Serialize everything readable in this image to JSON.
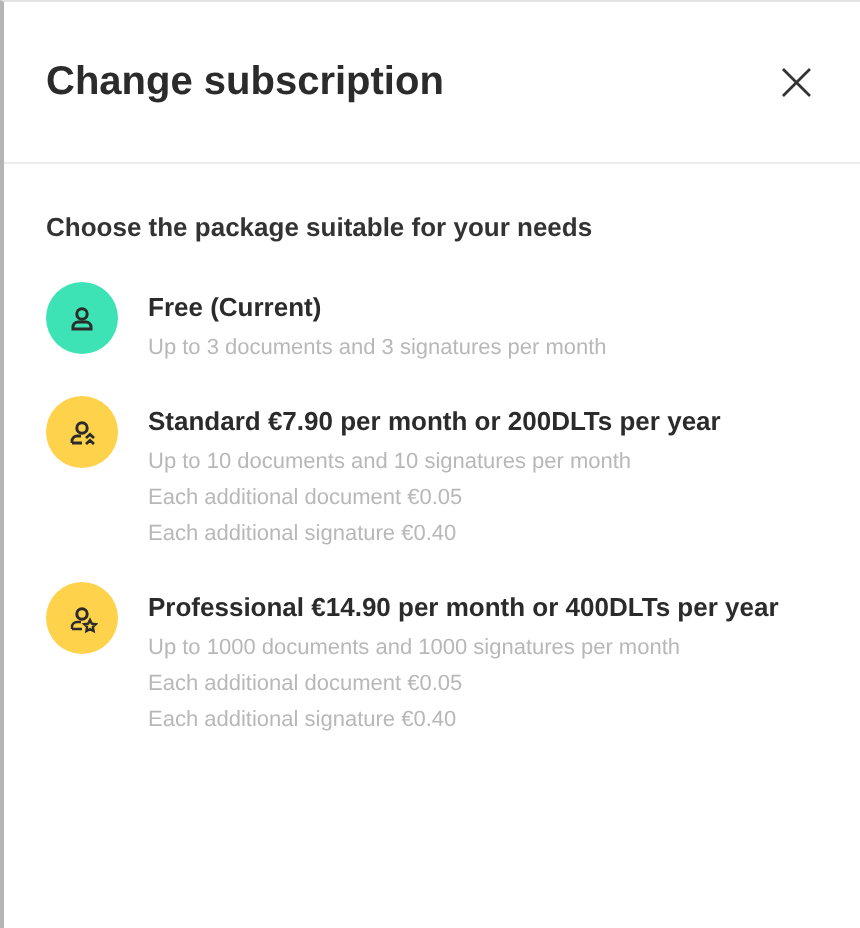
{
  "dialog": {
    "title": "Change subscription",
    "close": "×"
  },
  "intro": "Choose the package suitable for your needs",
  "packages": [
    {
      "kind": "person",
      "color": "#3de3b4",
      "name": "Free (Current)",
      "details": [
        "Up to 3 documents and 3 signatures per month"
      ]
    },
    {
      "kind": "person-up",
      "color": "#ffd24c",
      "name": "Standard €7.90 per month or 200DLTs per year",
      "details": [
        "Up to 10 documents and 10 signatures per month",
        "Each additional document €0.05",
        "Each additional signature €0.40"
      ]
    },
    {
      "kind": "person-star",
      "color": "#ffd24c",
      "name": "Professional €14.90 per month or 400DLTs per year",
      "details": [
        "Up to 1000 documents and 1000 signatures per month",
        "Each additional document €0.05",
        "Each additional signature €0.40"
      ]
    }
  ]
}
